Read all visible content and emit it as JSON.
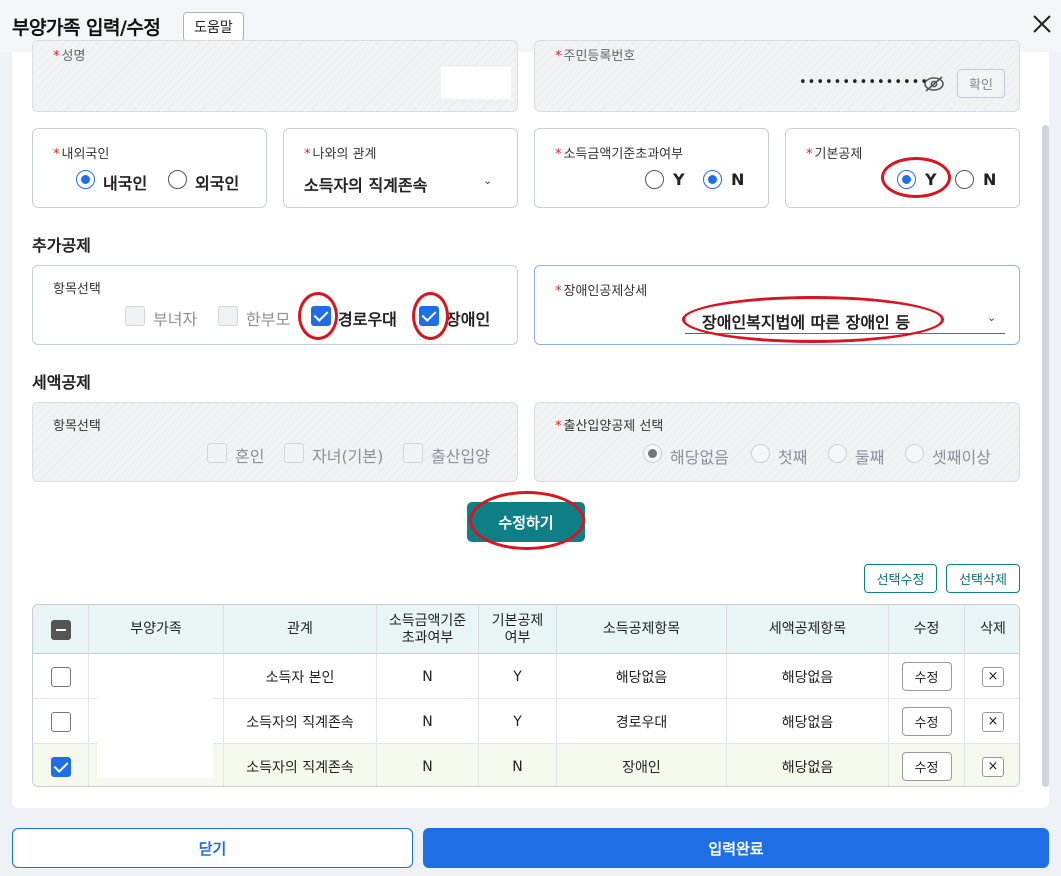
{
  "header": {
    "title": "부양가족 입력/수정",
    "help_label": "도움말"
  },
  "top_fields": {
    "name_label": "성명",
    "rrn_label": "주민등록번호",
    "rrn_masked": "•••••••••••••••",
    "confirm_label": "확인"
  },
  "nationality": {
    "label": "내외국인",
    "options": [
      "내국인",
      "외국인"
    ],
    "selected": "내국인"
  },
  "relation": {
    "label": "나와의 관계",
    "value": "소득자의 직계존속"
  },
  "income_exceed": {
    "label": "소득금액기준초과여부",
    "options": [
      "Y",
      "N"
    ],
    "selected": "N"
  },
  "basic_deduction": {
    "label": "기본공제",
    "options": [
      "Y",
      "N"
    ],
    "selected": "Y"
  },
  "extra_deduction": {
    "section_title": "추가공제",
    "items_label": "항목선택",
    "items": [
      {
        "label": "부녀자",
        "checked": false,
        "disabled": true
      },
      {
        "label": "한부모",
        "checked": false,
        "disabled": true
      },
      {
        "label": "경로우대",
        "checked": true,
        "disabled": false
      },
      {
        "label": "장애인",
        "checked": true,
        "disabled": false
      }
    ],
    "disability_detail_label": "장애인공제상세",
    "disability_detail_value": "장애인복지법에 따른 장애인 등"
  },
  "tax_credit": {
    "section_title": "세액공제",
    "items_label": "항목선택",
    "items": [
      {
        "label": "혼인",
        "checked": false
      },
      {
        "label": "자녀(기본)",
        "checked": false
      },
      {
        "label": "출산입양",
        "checked": false
      }
    ],
    "birth_label": "출산입양공제 선택",
    "birth_options": [
      "해당없음",
      "첫째",
      "둘째",
      "셋째이상"
    ],
    "birth_selected": "해당없음"
  },
  "actions": {
    "submit_label": "수정하기",
    "edit_selected_label": "선택수정",
    "delete_selected_label": "선택삭제"
  },
  "table": {
    "headers": [
      "부양가족",
      "관계",
      "소득금액기준 초과여부",
      "기본공제 여부",
      "소득공제항목",
      "세액공제항목",
      "수정",
      "삭제"
    ],
    "header_income_1": "소득금액기준",
    "header_income_2": "초과여부",
    "header_basic_1": "기본공제",
    "header_basic_2": "여부",
    "rows": [
      {
        "checked": false,
        "relation": "소득자 본인",
        "exceed": "N",
        "basic": "Y",
        "income_item": "해당없음",
        "tax_item": "해당없음",
        "edit": "수정",
        "delete": "×"
      },
      {
        "checked": false,
        "relation": "소득자의 직계존속",
        "exceed": "N",
        "basic": "Y",
        "income_item": "경로우대",
        "tax_item": "해당없음",
        "edit": "수정",
        "delete": "×"
      },
      {
        "checked": true,
        "relation": "소득자의 직계존속",
        "exceed": "N",
        "basic": "N",
        "income_item": "장애인",
        "tax_item": "해당없음",
        "edit": "수정",
        "delete": "×"
      }
    ]
  },
  "footer": {
    "close_label": "닫기",
    "done_label": "입력완료"
  },
  "colors": {
    "primary": "#1e6ee6",
    "teal": "#0f7f86",
    "annotation_red": "#d7141f"
  }
}
